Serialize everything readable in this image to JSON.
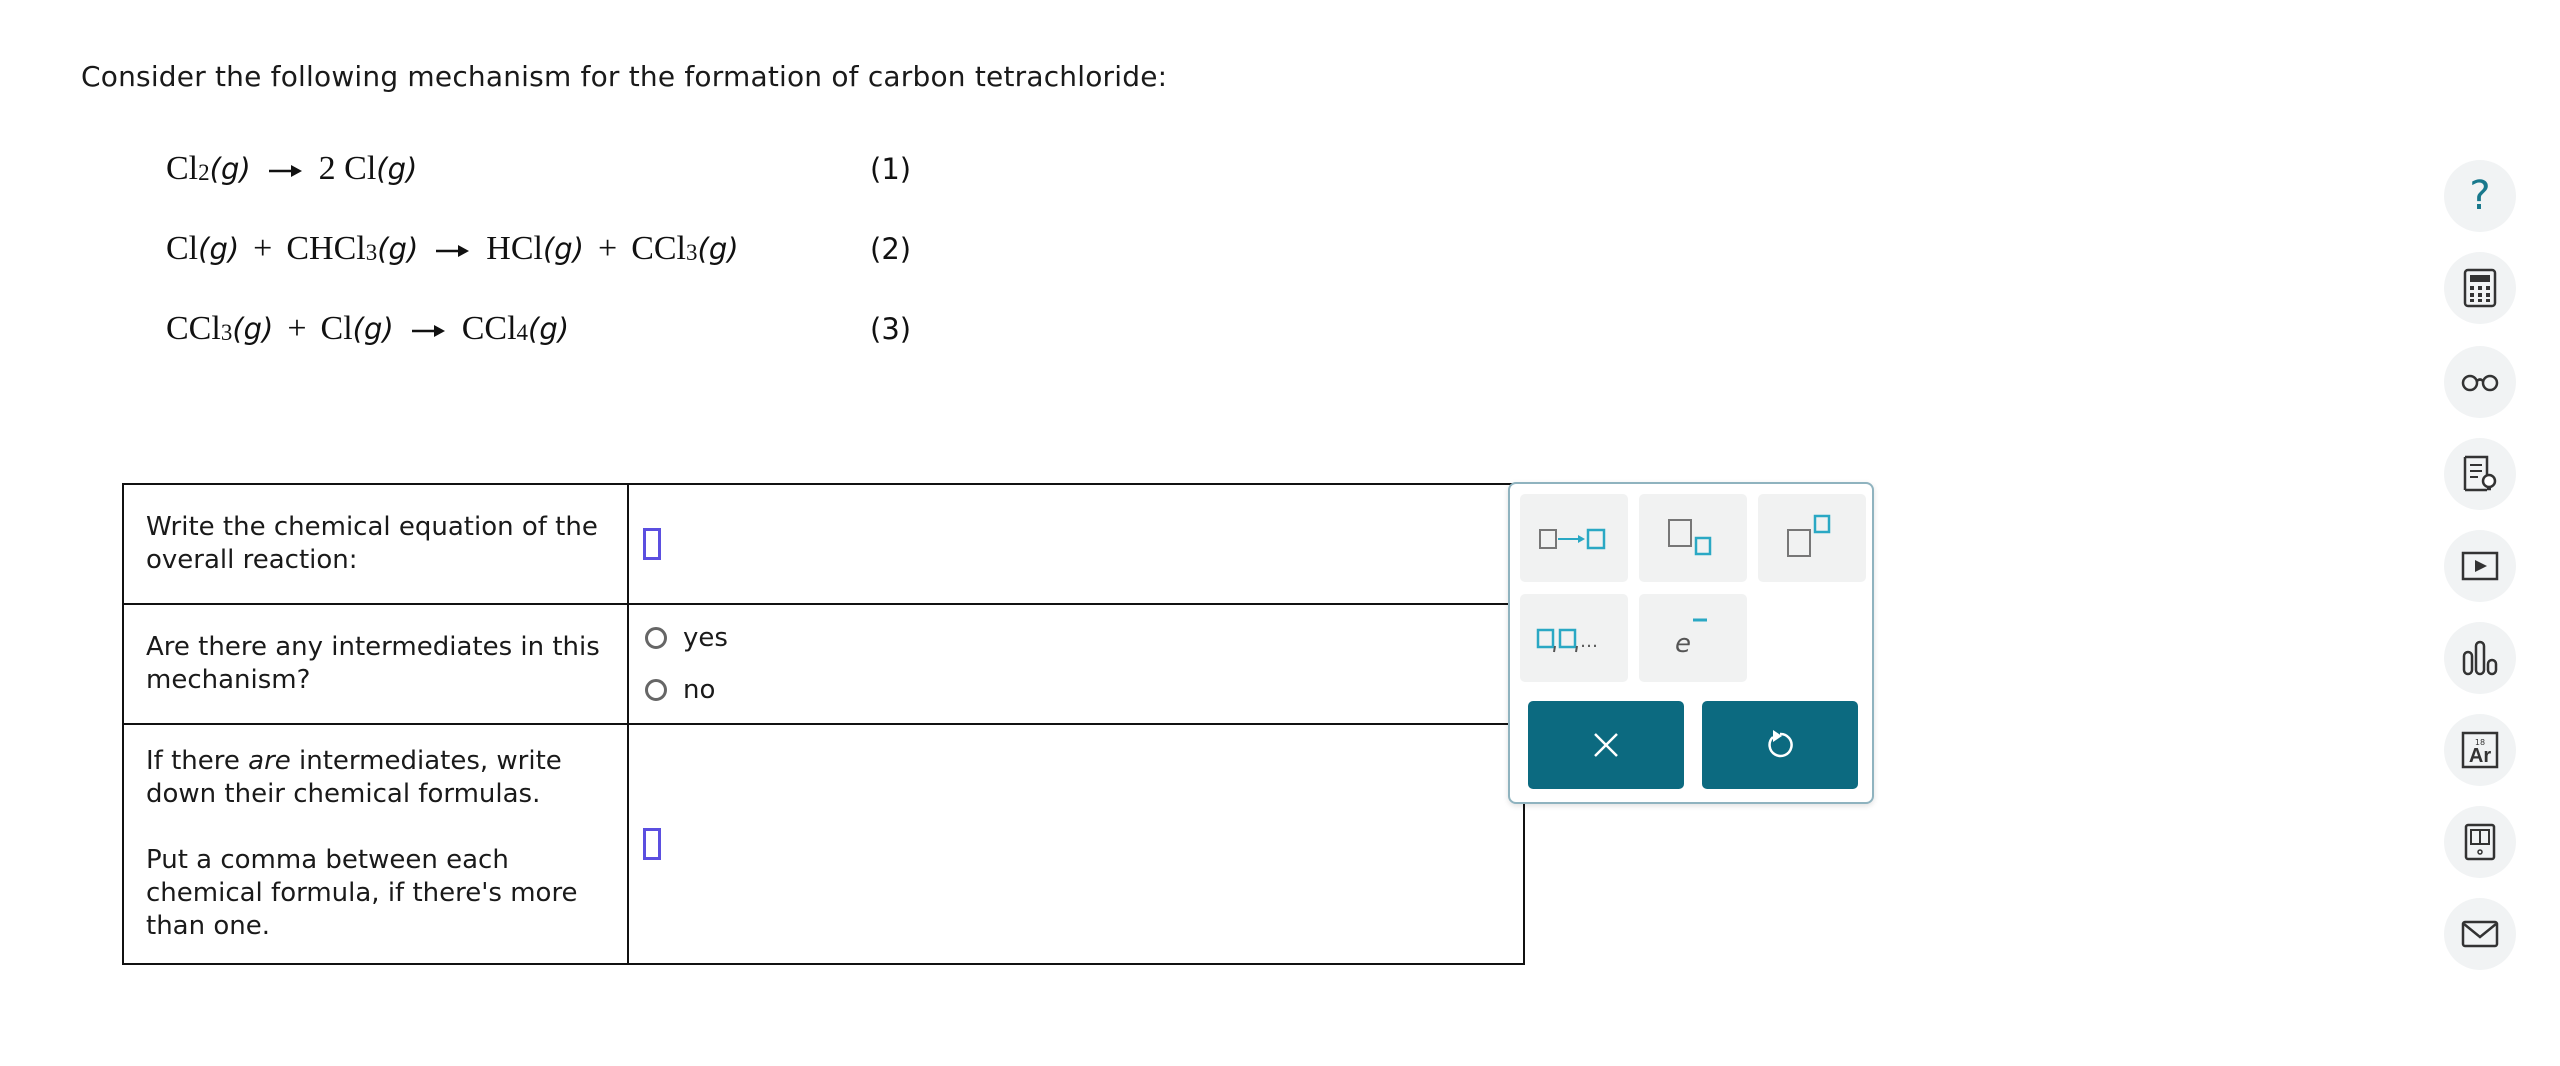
{
  "prompt": "Consider the following mechanism for the formation of carbon tetrachloride:",
  "mechanism": {
    "step1": {
      "number": "(1)"
    },
    "step2": {
      "number": "(2)"
    },
    "step3": {
      "number": "(3)"
    }
  },
  "questions": {
    "overall": {
      "label": "Write the chemical equation of the overall reaction:"
    },
    "intermediates_q": {
      "label": "Are there any intermediates in this mechanism?",
      "options": [
        "yes",
        "no"
      ]
    },
    "intermediates_formulas": {
      "label_prefix": "If there ",
      "label_emphasis": "are",
      "label_suffix": " intermediates, write down their chemical formulas.",
      "hint": "Put a comma between each chemical formula, if there's more than one."
    }
  },
  "palette": {
    "buttons": [
      "reaction-arrow",
      "subscript",
      "superscript",
      "list",
      "electron"
    ],
    "electron_label": "e",
    "list_label": "…",
    "actions": [
      "clear",
      "undo"
    ]
  },
  "sidebar_tools": [
    "help",
    "calculator",
    "reading-glasses",
    "explanation",
    "video",
    "data",
    "periodic-table",
    "textbook",
    "messages"
  ],
  "periodic_table_icon": {
    "number": "18",
    "symbol": "Ar"
  },
  "help_glyph": "?",
  "colors": {
    "accent": "#0c6a80",
    "slot": "#5b4fe0",
    "palette_teal": "#2aa8c4"
  }
}
